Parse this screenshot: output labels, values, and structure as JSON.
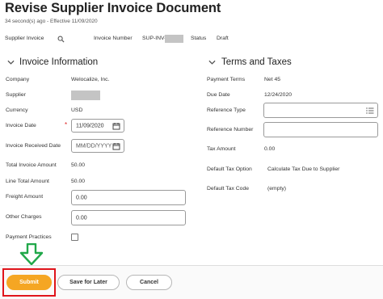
{
  "page": {
    "title": "Revise Supplier Invoice Document",
    "subtitle": "34 second(s) ago - Effective 11/09/2020"
  },
  "header": {
    "supplier_invoice_label": "Supplier Invoice",
    "invoice_number_label": "Invoice Number",
    "invoice_number_prefix": "SUP-INV-",
    "status_label": "Status",
    "status_value": "Draft"
  },
  "invoice_information": {
    "section_title": "Invoice Information",
    "company_label": "Company",
    "company_value": "Welocalize, Inc.",
    "supplier_label": "Supplier",
    "currency_label": "Currency",
    "currency_value": "USD",
    "invoice_date_label": "Invoice Date",
    "invoice_date_value": "11/09/2020",
    "invoice_received_date_label": "Invoice Received Date",
    "invoice_received_date_placeholder": "MM/DD/YYYY",
    "total_invoice_amount_label": "Total Invoice Amount",
    "total_invoice_amount_value": "50.00",
    "line_total_amount_label": "Line Total Amount",
    "line_total_amount_value": "50.00",
    "freight_amount_label": "Freight Amount",
    "freight_amount_value": "0.00",
    "other_charges_label": "Other Charges",
    "other_charges_value": "0.00",
    "payment_practices_label": "Payment Practices",
    "payment_practices_checked": false
  },
  "terms_and_taxes": {
    "section_title": "Terms and Taxes",
    "payment_terms_label": "Payment Terms",
    "payment_terms_value": "Net 45",
    "due_date_label": "Due Date",
    "due_date_value": "12/24/2020",
    "reference_type_label": "Reference Type",
    "reference_number_label": "Reference Number",
    "tax_amount_label": "Tax Amount",
    "tax_amount_value": "0.00",
    "default_tax_option_label": "Default Tax Option",
    "default_tax_option_value": "Calculate Tax Due to Supplier",
    "default_tax_code_label": "Default Tax Code",
    "default_tax_code_value": "(empty)"
  },
  "footer": {
    "submit_label": "Submit",
    "save_for_later_label": "Save for Later",
    "cancel_label": "Cancel"
  },
  "colors": {
    "primary_button": "#f5a623",
    "highlight_box": "#e0141b",
    "arrow": "#21a84a"
  },
  "icons": {
    "search": "search-icon",
    "calendar": "calendar-icon",
    "menu": "menu-icon",
    "chevron": "chevron-down-icon",
    "arrow": "arrow-down-icon"
  }
}
